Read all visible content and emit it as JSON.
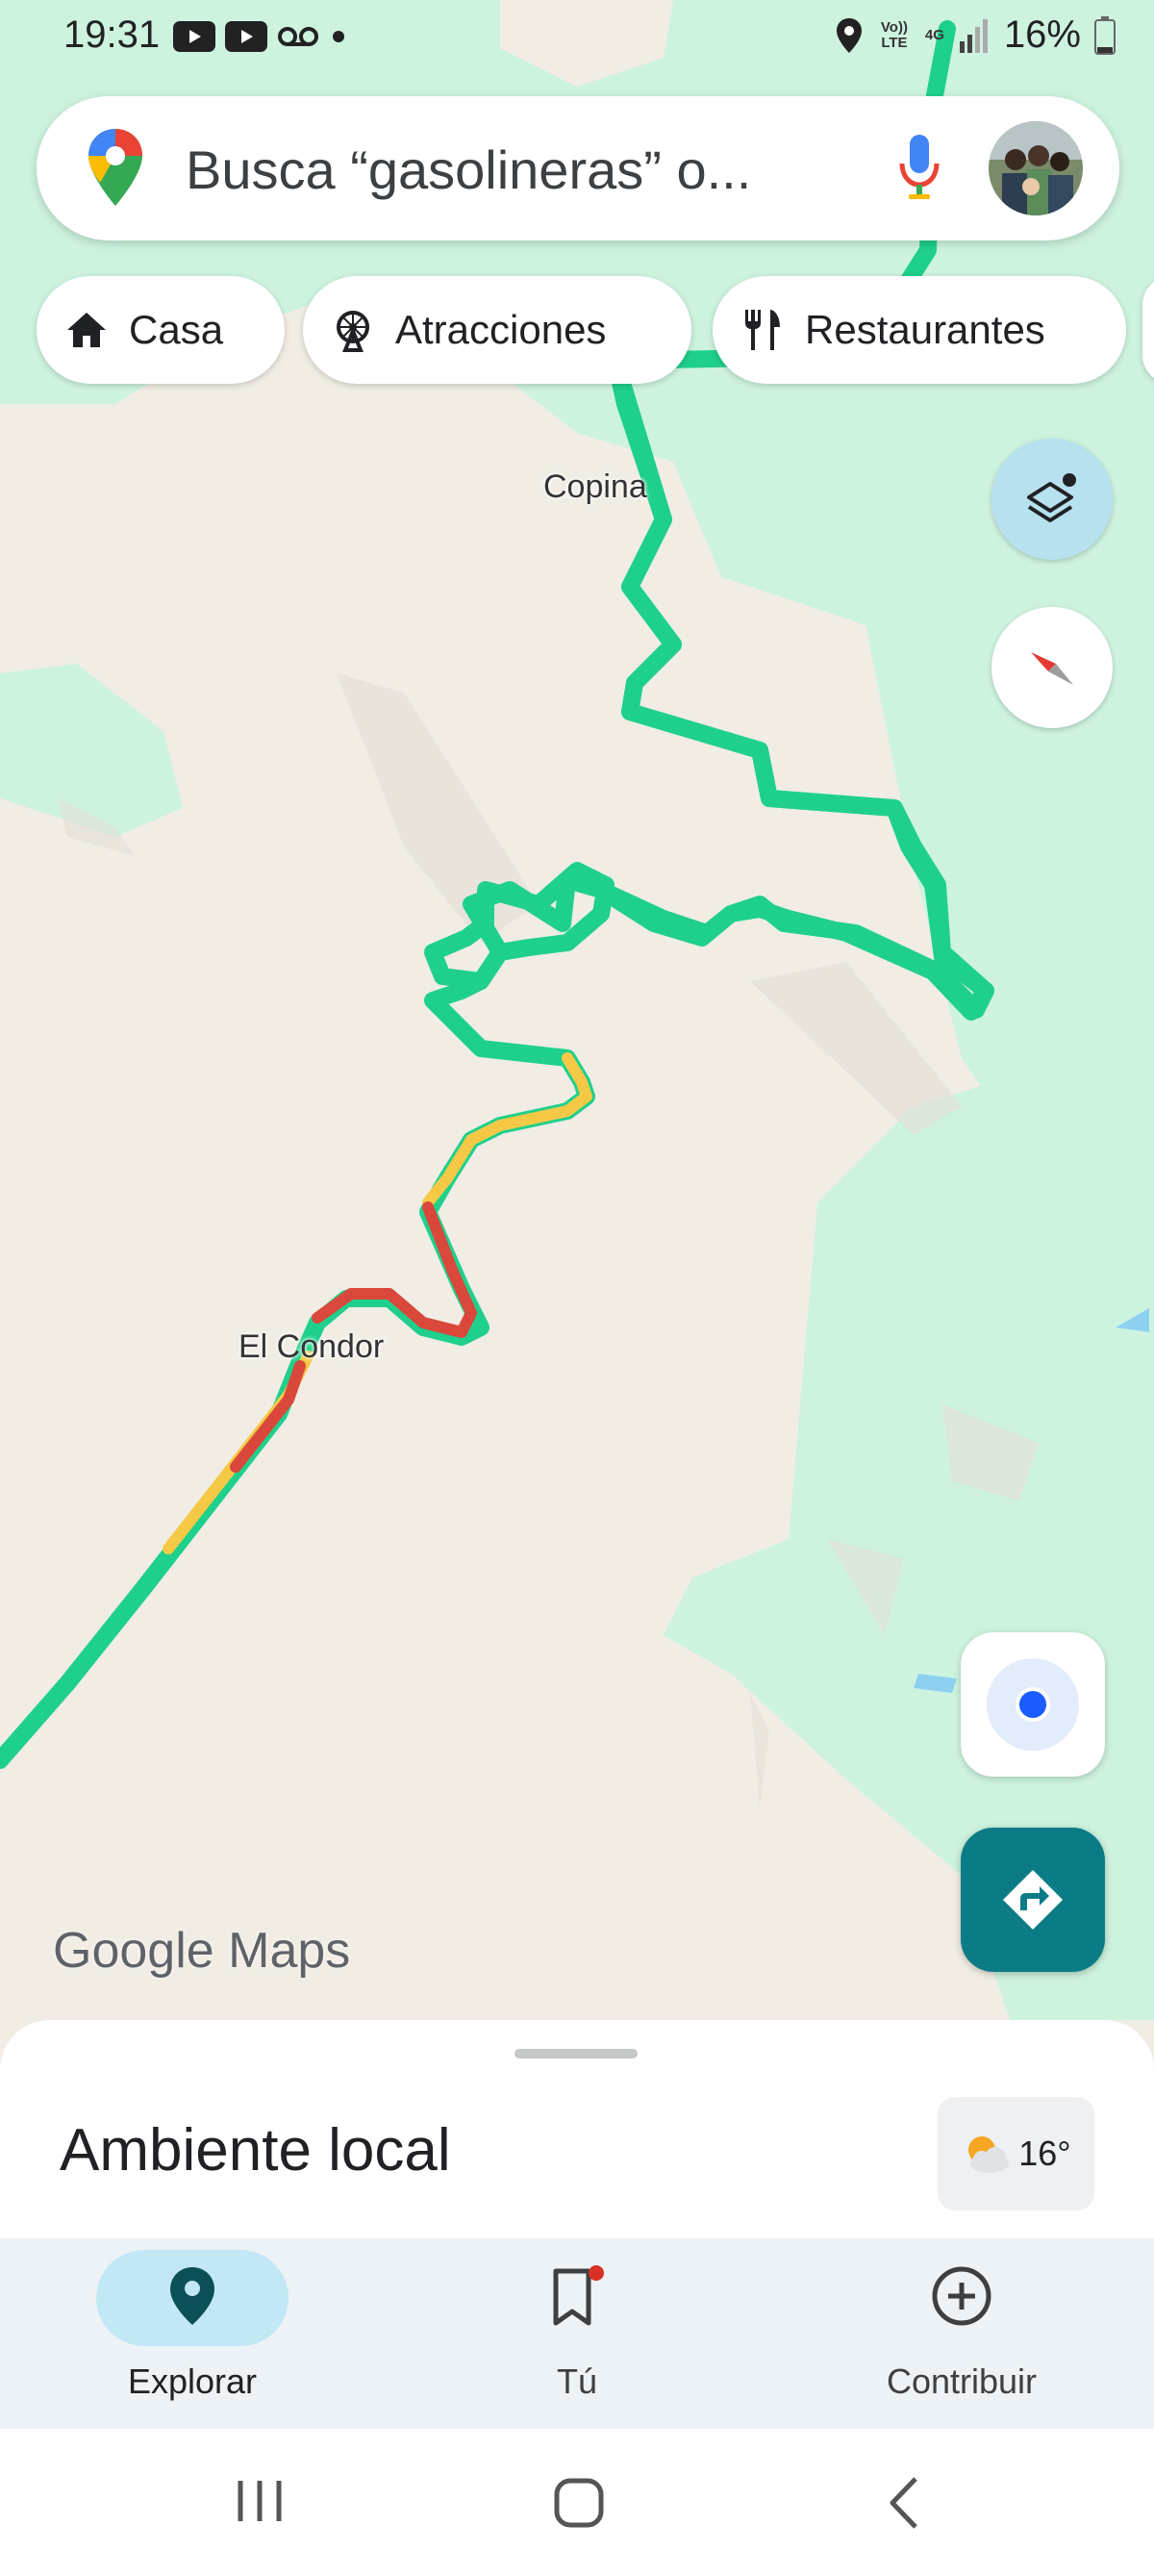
{
  "status_bar": {
    "time": "19:31",
    "net_top": "Vo)) LTE",
    "net_type": "4G",
    "battery": "16%"
  },
  "search": {
    "placeholder": "Busca “gasolineras” o..."
  },
  "chips": [
    {
      "label": "Casa",
      "icon": "home-icon"
    },
    {
      "label": "Atracciones",
      "icon": "ferris-wheel-icon"
    },
    {
      "label": "Restaurantes",
      "icon": "restaurant-icon"
    }
  ],
  "map": {
    "labels": {
      "copina": "Copina",
      "el_condor": "El Condor"
    },
    "logo": "Google Maps",
    "traffic_colors": {
      "free": "#1fd08c",
      "slow": "#f5c945",
      "heavy": "#d9483b"
    }
  },
  "sheet": {
    "title": "Ambiente local",
    "temperature": "16°"
  },
  "bottom_nav": {
    "explore": "Explorar",
    "you": "Tú",
    "contribute": "Contribuir"
  },
  "colors": {
    "accent": "#0b7c86",
    "location_blue": "#1a5cff",
    "active_pill": "#c2e7f5"
  }
}
